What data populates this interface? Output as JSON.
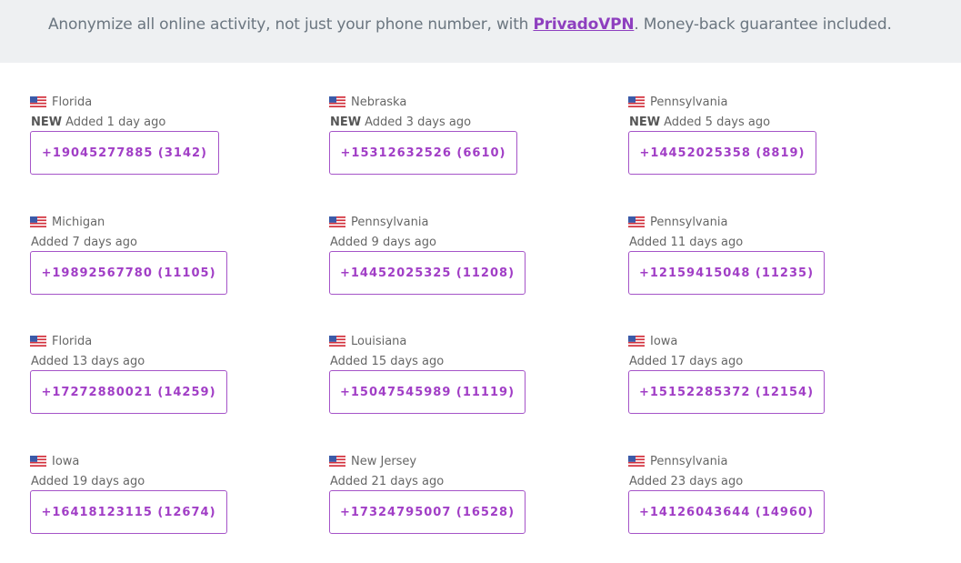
{
  "banner": {
    "prefix": "Anonymize all online activity, not just your phone number, with ",
    "link": "PrivadoVPN",
    "suffix": ". Money-back guarantee included."
  },
  "new_label": "NEW",
  "colors": {
    "accent": "#a13ec6",
    "banner_bg": "#eef0f2"
  },
  "numbers": [
    {
      "location": "Florida",
      "added": "Added 1 day ago",
      "new": true,
      "number": "+19045277885 (3142)"
    },
    {
      "location": "Nebraska",
      "added": "Added 3 days ago",
      "new": true,
      "number": "+15312632526 (6610)"
    },
    {
      "location": "Pennsylvania",
      "added": "Added 5 days ago",
      "new": true,
      "number": "+14452025358 (8819)"
    },
    {
      "location": "Michigan",
      "added": "Added 7 days ago",
      "new": false,
      "number": "+19892567780 (11105)"
    },
    {
      "location": "Pennsylvania",
      "added": "Added 9 days ago",
      "new": false,
      "number": "+14452025325 (11208)"
    },
    {
      "location": "Pennsylvania",
      "added": "Added 11 days ago",
      "new": false,
      "number": "+12159415048 (11235)"
    },
    {
      "location": "Florida",
      "added": "Added 13 days ago",
      "new": false,
      "number": "+17272880021 (14259)"
    },
    {
      "location": "Louisiana",
      "added": "Added 15 days ago",
      "new": false,
      "number": "+15047545989 (11119)"
    },
    {
      "location": "Iowa",
      "added": "Added 17 days ago",
      "new": false,
      "number": "+15152285372 (12154)"
    },
    {
      "location": "Iowa",
      "added": "Added 19 days ago",
      "new": false,
      "number": "+16418123115 (12674)"
    },
    {
      "location": "New Jersey",
      "added": "Added 21 days ago",
      "new": false,
      "number": "+17324795007 (16528)"
    },
    {
      "location": "Pennsylvania",
      "added": "Added 23 days ago",
      "new": false,
      "number": "+14126043644 (14960)"
    }
  ]
}
